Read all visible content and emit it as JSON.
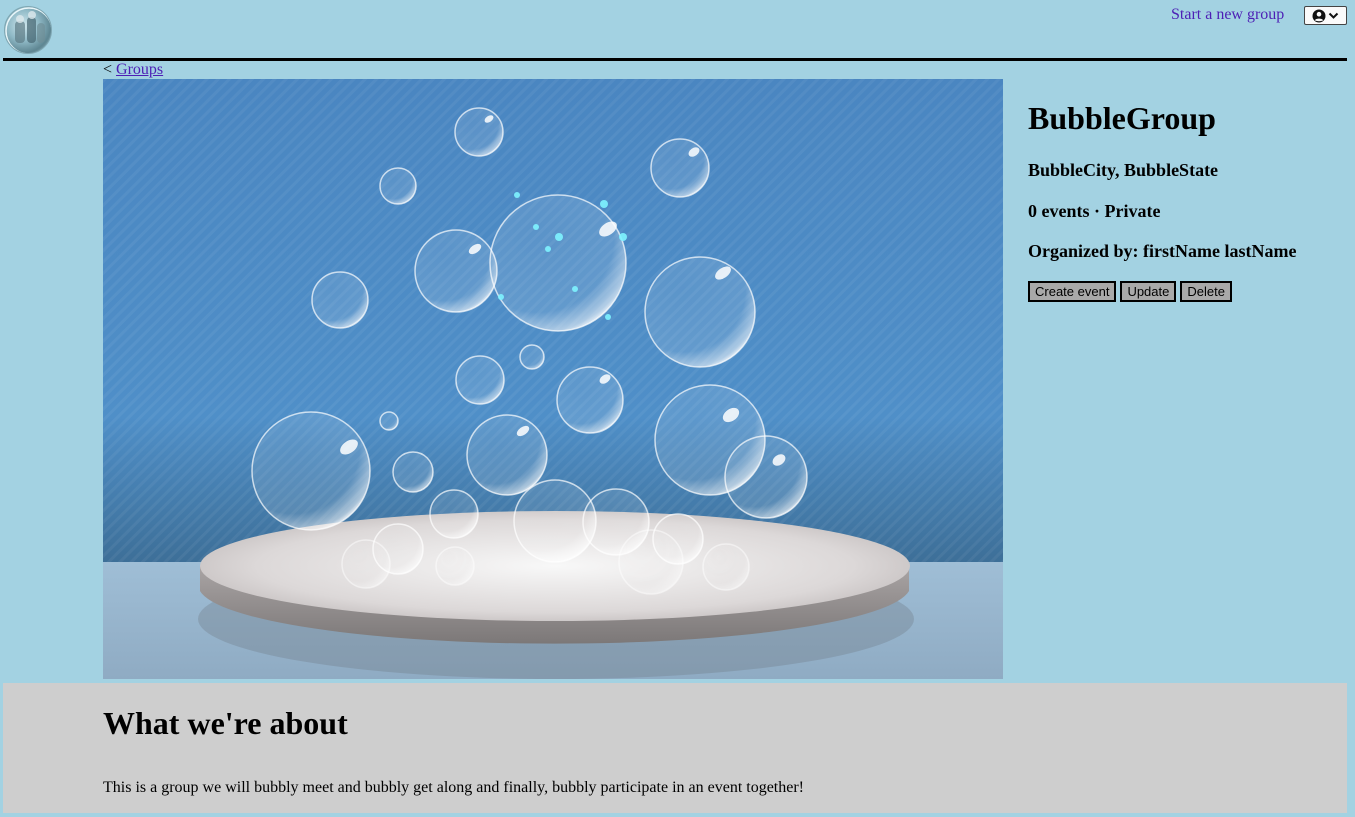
{
  "header": {
    "logo_icon": "bubble-logo",
    "start_group_label": "Start a new group",
    "profile_icon": "user-circle-icon",
    "profile_caret_icon": "chevron-down-icon"
  },
  "breadcrumb": {
    "prefix": "<",
    "link_label": "Groups"
  },
  "group": {
    "name": "BubbleGroup",
    "location": "BubbleCity, BubbleState",
    "stats": "0 events · Private",
    "organizer": "Organized by: firstName lastName",
    "actions": {
      "create_event": "Create event",
      "update": "Update",
      "delete": "Delete"
    }
  },
  "about": {
    "heading": "What we're about",
    "description": "This is a group we will bubbly meet and bubbly get along and finally, bubbly participate in an event together!"
  },
  "colors": {
    "page_background": "#a3d2e2",
    "link": "#4d1fb5",
    "about_background": "#cecece",
    "button_background": "#a9a9a9"
  }
}
